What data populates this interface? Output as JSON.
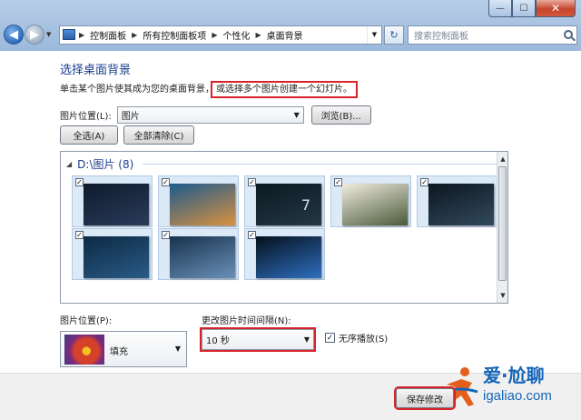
{
  "window": {
    "minimize_glyph": "—",
    "maximize_glyph": "☐",
    "close_glyph": "✕"
  },
  "nav": {
    "back_glyph": "◀",
    "forward_glyph": "▶",
    "breadcrumbs": [
      "控制面板",
      "所有控制面板项",
      "个性化",
      "桌面背景"
    ],
    "search_placeholder": "搜索控制面板",
    "refresh_glyph": "↻"
  },
  "header": {
    "title": "选择桌面背景",
    "subtitle_part1": "单击某个图片使其成为您的桌面背景，",
    "subtitle_part2": "或选择多个图片创建一个幻灯片。"
  },
  "location": {
    "label": "图片位置(L):",
    "value": "图片",
    "browse_label": "浏览(B)...",
    "select_all_label": "全选(A)",
    "clear_all_label": "全部清除(C)"
  },
  "gallery": {
    "group_title": "D:\\图片 (8)",
    "items": [
      {
        "checked": true,
        "colors": [
          "#0f1a2c",
          "#2a3b5a"
        ],
        "icon": "night-sky-image"
      },
      {
        "checked": true,
        "colors": [
          "#1d5a8e",
          "#d8913f"
        ],
        "icon": "city-skyline-image"
      },
      {
        "checked": true,
        "colors": [
          "#0b1a22",
          "#243744"
        ],
        "icon": "number-seven-image",
        "overlay": "7"
      },
      {
        "checked": true,
        "colors": [
          "#f1ecdf",
          "#4a5a3a"
        ],
        "icon": "architecture-image"
      },
      {
        "checked": true,
        "colors": [
          "#0c1620",
          "#324a5c"
        ],
        "icon": "dark-abstract-image"
      },
      {
        "checked": true,
        "colors": [
          "#0d2a44",
          "#295a86"
        ],
        "icon": "night-road-image"
      },
      {
        "checked": true,
        "colors": [
          "#17324d",
          "#6a90b8"
        ],
        "icon": "lakeside-image"
      },
      {
        "checked": true,
        "colors": [
          "#05101c",
          "#2e6fc0"
        ],
        "icon": "blue-sphere-image"
      }
    ]
  },
  "position": {
    "label": "图片位置(P):",
    "value": "填充"
  },
  "interval": {
    "label": "更改图片时间间隔(N):",
    "value": "10 秒"
  },
  "shuffle": {
    "label": "无序播放(S)",
    "checked": true
  },
  "footer": {
    "save_label": "保存修改"
  },
  "watermark": {
    "brand": "爱·尬聊",
    "url": "igaliao.com"
  }
}
